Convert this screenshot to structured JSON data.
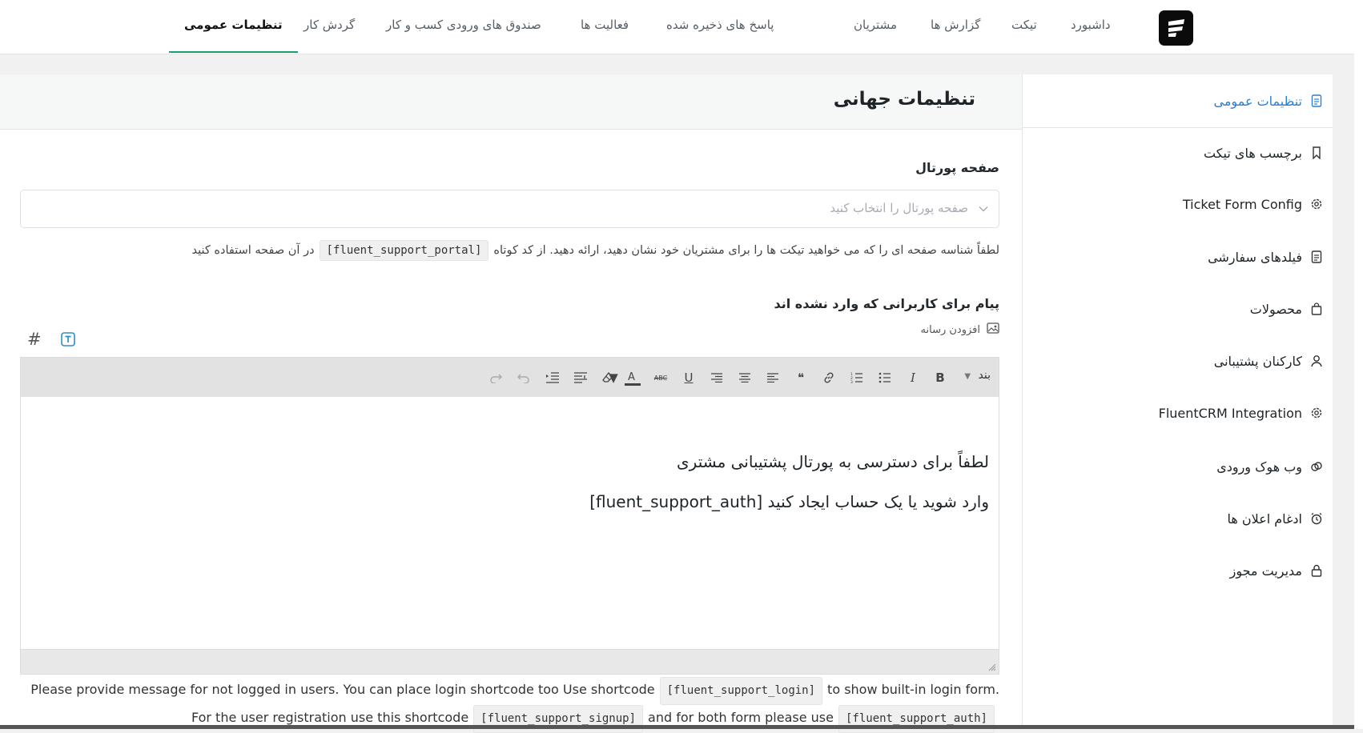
{
  "nav": {
    "items": [
      {
        "label": "داشبورد"
      },
      {
        "label": "تیکت"
      },
      {
        "label": "گزارش ها"
      },
      {
        "label": "مشتریان"
      },
      {
        "label": "پاسخ های ذخیره شده"
      },
      {
        "label": "فعالیت ها"
      },
      {
        "label": "صندوق های ورودی کسب و کار"
      },
      {
        "label": "گردش کار"
      },
      {
        "label": "تنظیمات عمومی"
      }
    ],
    "active": "تنظیمات عمومی"
  },
  "sidebar": {
    "items": [
      {
        "label": "تنظیمات عمومی",
        "icon": "document-icon"
      },
      {
        "label": "برچسب های تیکت",
        "icon": "bookmark-icon"
      },
      {
        "label": "Ticket Form Config",
        "icon": "gear-icon"
      },
      {
        "label": "فیلدهای سفارشی",
        "icon": "document-icon"
      },
      {
        "label": "محصولات",
        "icon": "bag-icon"
      },
      {
        "label": "کارکنان پشتیبانی",
        "icon": "user-icon"
      },
      {
        "label": "FluentCRM Integration",
        "icon": "gear-icon"
      },
      {
        "label": "وب هوک ورودی",
        "icon": "link-icon"
      },
      {
        "label": "ادغام اعلان ها",
        "icon": "alarm-icon"
      },
      {
        "label": "مدیریت مجوز",
        "icon": "lock-icon"
      }
    ]
  },
  "page": {
    "title": "تنظیمات جهانی"
  },
  "portal": {
    "label": "صفحه پورتال",
    "placeholder": "صفحه پورتال را انتخاب کنید",
    "help_before": "لطفاً شناسه صفحه ای را که می خواهید تیکت ها را برای مشتریان خود نشان دهید، ارائه دهید. از کد کوتاه",
    "help_code": "[fluent_support_portal]",
    "help_after": "در آن صفحه استفاده کنید"
  },
  "message": {
    "label": "پیام برای کاربرانی که وارد نشده اند",
    "add_media": "افزودن رسانه",
    "format_label": "بند",
    "line1": "لطفاً برای دسترسی به پورتال پشتیبانی مشتری",
    "line2": "وارد شوید یا یک حساب ایجاد کنید [fluent_support_auth]",
    "help_part1": "Please provide message for not logged in users. You can place login shortcode too Use shortcode",
    "help_code1": "[fluent_support_login]",
    "help_part2": "to show built-in login form.",
    "help_part3": "For the user registration use this shortcode",
    "help_code2": "[fluent_support_signup]",
    "help_part4": "and for both form please use",
    "help_code3": "[fluent_support_auth]"
  },
  "colors": {
    "accent_green": "#14a36a",
    "sidebar_active": "#2b7fd0"
  }
}
